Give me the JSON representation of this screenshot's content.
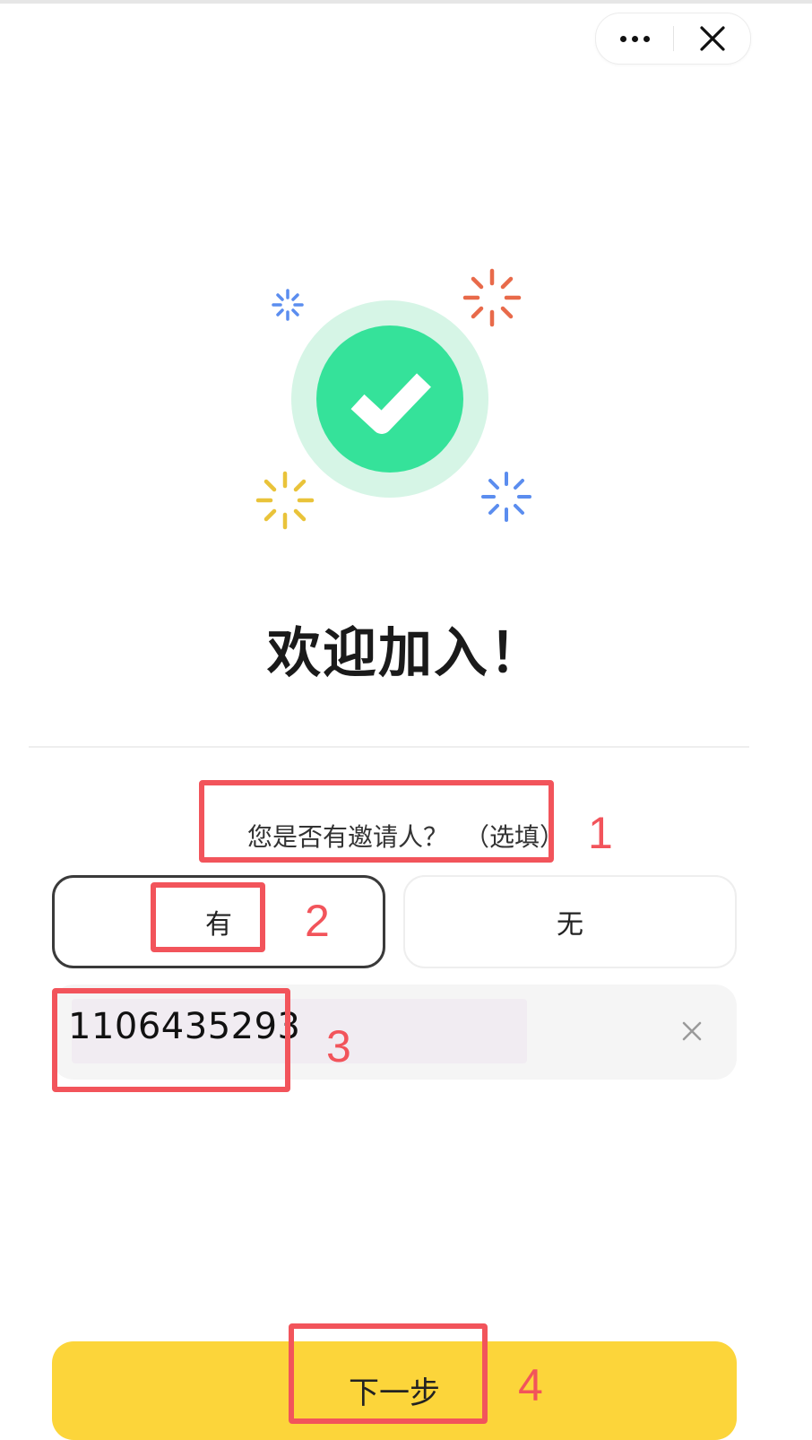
{
  "header": {
    "more_icon": "more-dots-icon",
    "close_icon": "close-icon"
  },
  "hero": {
    "icon": "success-check-icon",
    "accent": "#35e29a",
    "sparkles": [
      "#5b8def",
      "#e86a4a",
      "#e9c33a",
      "#5b8def"
    ]
  },
  "welcome": {
    "title": "欢迎加入！"
  },
  "inviter": {
    "question": "您是否有邀请人？",
    "question_hint": "（选填）",
    "options": [
      {
        "label": "有",
        "selected": true
      },
      {
        "label": "无",
        "selected": false
      }
    ],
    "input_value": "1106435293",
    "clear_icon": "clear-x-icon"
  },
  "footer": {
    "next_label": "下一步",
    "accent": "#fcd53a"
  },
  "annotations": {
    "labels": [
      "1",
      "2",
      "3",
      "4"
    ],
    "color": "#f2545b"
  }
}
